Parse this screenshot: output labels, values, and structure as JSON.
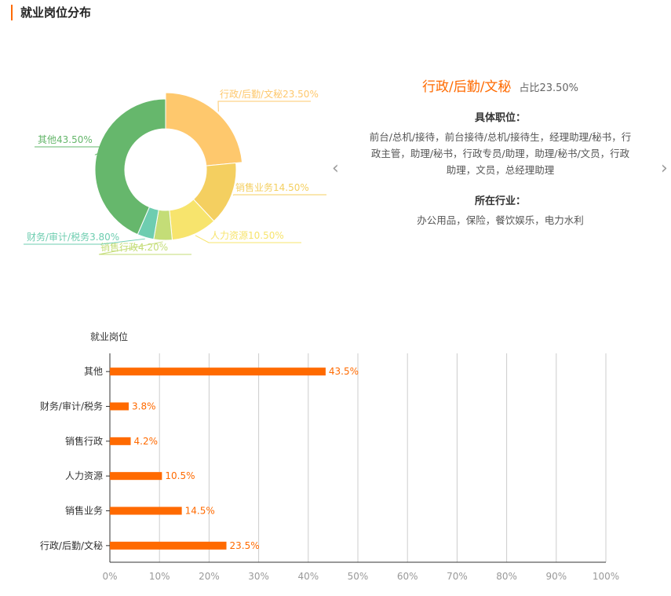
{
  "section_title": "就业岗位分布",
  "detail": {
    "title": "行政/后勤/文秘",
    "share": "占比23.50%",
    "positions_heading": "具体职位：",
    "positions": "前台/总机/接待，前台接待/总机/接待生，经理助理/秘书，行政主管，助理/秘书，行政专员/助理，助理/秘书/文员，行政助理，文员，总经理助理",
    "industries_heading": "所在行业：",
    "industries": "办公用品，保险，餐饮娱乐，电力水利"
  },
  "nav": {
    "prev_icon": "chevron-left-icon",
    "next_icon": "chevron-right-icon",
    "prev": "‹",
    "next": "›"
  },
  "chart_data": [
    {
      "type": "pie",
      "variant": "donut",
      "labels": [
        "行政/后勤/文秘",
        "销售业务",
        "人力资源",
        "销售行政",
        "财务/审计/税务",
        "其他"
      ],
      "values": [
        23.5,
        14.5,
        10.5,
        4.2,
        3.8,
        43.5
      ],
      "label_texts": [
        "行政/后勤/文秘23.50%",
        "销售业务14.50%",
        "人力资源10.50%",
        "销售行政4.20%",
        "财务/审计/税务3.80%",
        "其他43.50%"
      ],
      "colors": [
        "#fec86d",
        "#f4cf60",
        "#f7e46d",
        "#c4dd77",
        "#6ecdb0",
        "#66b76c"
      ],
      "selected": "行政/后勤/文秘"
    },
    {
      "type": "bar",
      "orientation": "horizontal",
      "title": "就业岗位",
      "categories": [
        "其他",
        "财务/审计/税务",
        "销售行政",
        "人力资源",
        "销售业务",
        "行政/后勤/文秘"
      ],
      "values": [
        43.5,
        3.8,
        4.2,
        10.5,
        14.5,
        23.5
      ],
      "value_labels": [
        "43.5%",
        "3.8%",
        "4.2%",
        "10.5%",
        "14.5%",
        "23.5%"
      ],
      "xlim": [
        0,
        100
      ],
      "xticks": [
        "0%",
        "10%",
        "20%",
        "30%",
        "40%",
        "50%",
        "60%",
        "70%",
        "80%",
        "90%",
        "100%"
      ],
      "grid": true,
      "color": "#ff6a00"
    }
  ]
}
